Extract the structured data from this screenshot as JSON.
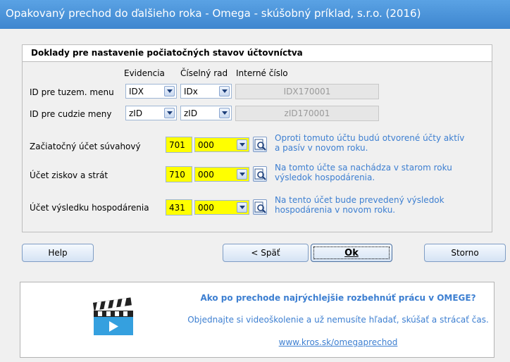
{
  "window": {
    "title": "Opakovaný prechod do ďalšieho roka - Omega - skúšobný príklad, s.r.o. (2016)"
  },
  "group": {
    "title": "Doklady pre nastavenie počiatočných stavov účtovníctva",
    "columns": {
      "evidencia": "Evidencia",
      "ciselny_rad": "Číselný rad",
      "interne_cislo": "Interné číslo"
    },
    "rows": [
      {
        "label": "ID pre tuzem. menu",
        "evidencia": "IDX",
        "ciselny_rad": "IDx",
        "interne_cislo": "IDX170001"
      },
      {
        "label": "ID pre cudzie meny",
        "evidencia": "zID",
        "ciselny_rad": "zID",
        "interne_cislo": "zID170001"
      }
    ],
    "accounts": [
      {
        "label": "Začiatočný účet súvahový",
        "synt": "701",
        "anal": "000",
        "hint_line1": "Oproti tomuto účtu budú otvorené účty aktív",
        "hint_line2": "a pasív v novom roku."
      },
      {
        "label": "Účet ziskov a strát",
        "synt": "710",
        "anal": "000",
        "hint_line1": "Na tomto účte sa nachádza v starom roku",
        "hint_line2": "výsledok hospodárenia."
      },
      {
        "label": "Účet výsledku hospodárenia",
        "synt": "431",
        "anal": "000",
        "hint_line1": "Na tento účet bude prevedený výsledok",
        "hint_line2": "hospodárenia v novom roku."
      }
    ]
  },
  "buttons": {
    "help": "Help",
    "back": "< Späť",
    "ok": "Ok",
    "cancel": "Storno"
  },
  "promo": {
    "heading": "Ako po prechode najrýchlejšie rozbehnúť prácu v OMEGE?",
    "text": "Objednajte si videoškolenie a už nemusíte hľadať, skúšať a strácať čas.",
    "link": "www.kros.sk/omegaprechod",
    "icon": "video-clapperboard-icon"
  },
  "colors": {
    "titlebar": "#4a93dc",
    "hint": "#3d7fd1",
    "highlight": "#ffff00"
  }
}
